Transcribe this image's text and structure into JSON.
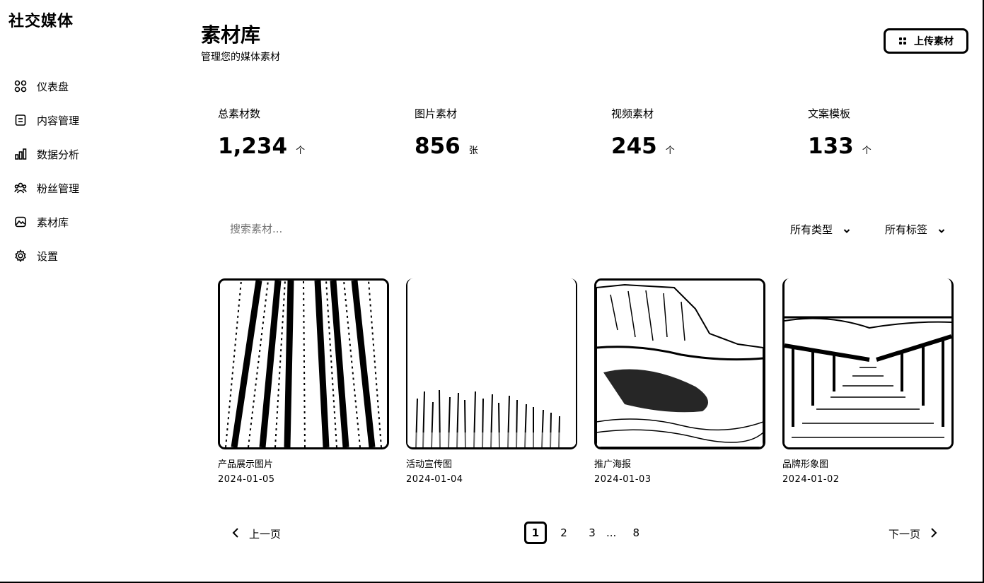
{
  "app": {
    "brand": "社交媒体"
  },
  "sidebar": {
    "items": [
      {
        "label": "仪表盘",
        "icon": "dashboard-icon"
      },
      {
        "label": "内容管理",
        "icon": "document-icon"
      },
      {
        "label": "数据分析",
        "icon": "bar-chart-icon"
      },
      {
        "label": "粉丝管理",
        "icon": "users-icon"
      },
      {
        "label": "素材库",
        "icon": "image-icon"
      },
      {
        "label": "设置",
        "icon": "gear-icon"
      }
    ]
  },
  "header": {
    "title": "素材库",
    "subtitle": "管理您的媒体素材",
    "upload_label": "上传素材"
  },
  "stats": [
    {
      "label": "总素材数",
      "value": "1,234",
      "unit": "个"
    },
    {
      "label": "图片素材",
      "value": "856",
      "unit": "张"
    },
    {
      "label": "视频素材",
      "value": "245",
      "unit": "个"
    },
    {
      "label": "文案模板",
      "value": "133",
      "unit": "个"
    }
  ],
  "filters": {
    "search_placeholder": "搜索素材...",
    "type_select": "所有类型",
    "tag_select": "所有标签"
  },
  "cards": [
    {
      "title": "产品展示图片",
      "date": "2024-01-05"
    },
    {
      "title": "活动宣传图",
      "date": "2024-01-04"
    },
    {
      "title": "推广海报",
      "date": "2024-01-03"
    },
    {
      "title": "品牌形象图",
      "date": "2024-01-02"
    }
  ],
  "pagination": {
    "prev_label": "上一页",
    "next_label": "下一页",
    "pages": [
      "1",
      "2",
      "3",
      "8"
    ],
    "ellipsis": "...",
    "current": "1"
  }
}
